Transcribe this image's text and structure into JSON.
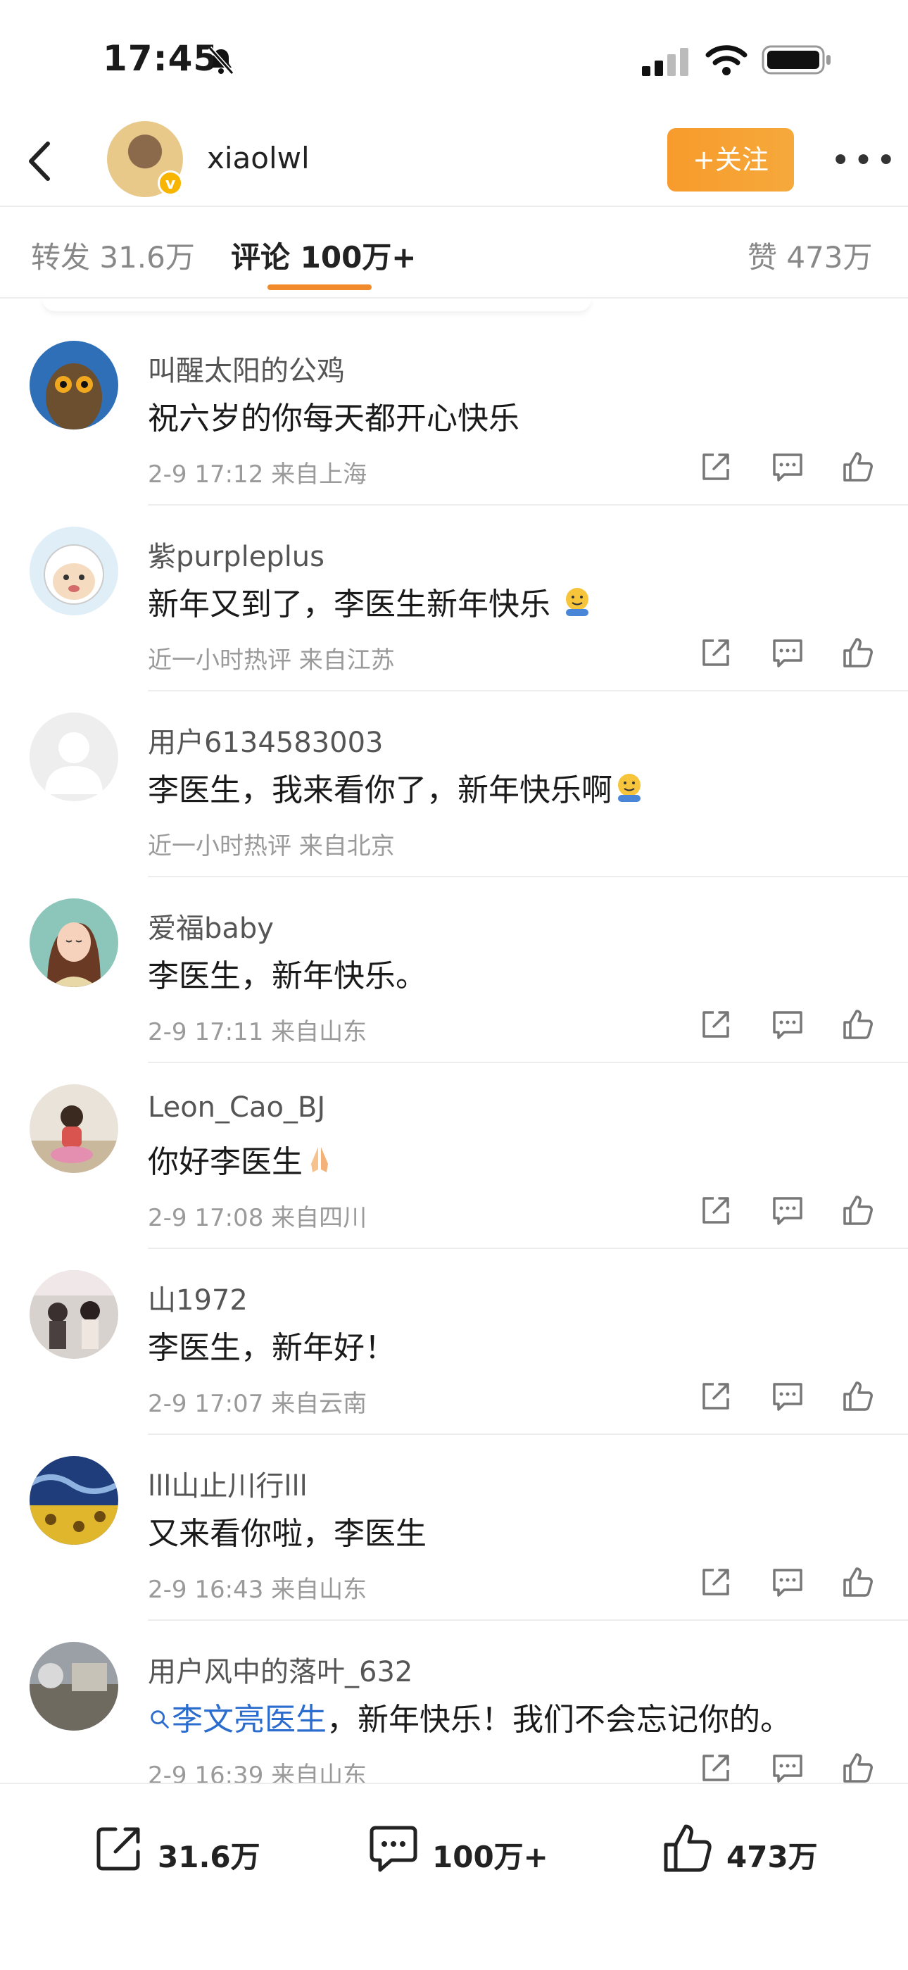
{
  "status": {
    "time": "17:45"
  },
  "header": {
    "username": "xiaolwl",
    "follow_label": "+关注",
    "more_label": "•••",
    "verified_mark": "v"
  },
  "tabs": {
    "repost": "转发 31.6万",
    "comment": "评论 100万+",
    "like": "赞 473万"
  },
  "comments": [
    {
      "name": "叫醒太阳的公鸡",
      "text": "祝六岁的你每天都开心快乐",
      "meta": "2-9 17:12  来自上海"
    },
    {
      "name": "紫purpleplus",
      "text": "新年又到了，李医生新年快乐",
      "meta": "近一小时热评  来自江苏"
    },
    {
      "name": "用户6134583003",
      "text": "李医生，我来看你了，新年快乐啊",
      "meta": "近一小时热评  来自北京"
    },
    {
      "name": "爱福baby",
      "text": "李医生，新年快乐。",
      "meta": "2-9 17:11  来自山东"
    },
    {
      "name": "Leon_Cao_BJ",
      "text": "你好李医生",
      "meta": "2-9 17:08  来自四川"
    },
    {
      "name": "山1972",
      "text": "李医生，新年好！",
      "meta": "2-9 17:07  来自云南"
    },
    {
      "name": "lll山止川行lll",
      "text": "又来看你啦，李医生",
      "meta": "2-9 16:43  来自山东"
    },
    {
      "name": "用户风中的落叶_632",
      "link": "李文亮医生",
      "text": "，新年快乐！我们不会忘记你的。",
      "meta": "2-9 16:39  来自山东"
    }
  ],
  "bottom": {
    "repost_count": "31.6万",
    "comment_count": "100万+",
    "like_count": "473万"
  },
  "colors": {
    "accent": "#f08a2a",
    "link": "#2b6ccf",
    "verified": "#f7b500"
  }
}
